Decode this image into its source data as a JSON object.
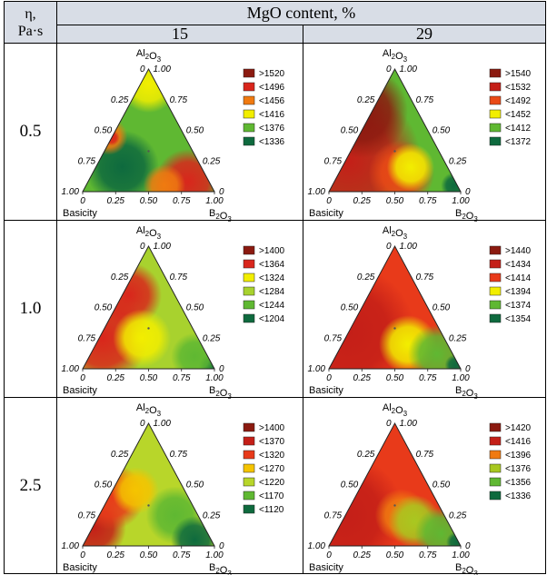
{
  "header": {
    "eta_label_line1": "η,",
    "eta_label_line2": "Pa·s",
    "mgo_title": "MgO content, %",
    "columns": [
      "15",
      "29"
    ]
  },
  "corner_labels": {
    "top": "Al2O3",
    "bottom_left": "Basicity",
    "bottom_right": "B2O3"
  },
  "ticks": {
    "bottom": [
      "0",
      "0.25",
      "0.50",
      "0.75",
      "1.00"
    ],
    "left": [
      "1.00",
      "0.75",
      "0.50",
      "0.25",
      "0"
    ],
    "right": [
      "1.00",
      "0.75",
      "0.50",
      "0.25",
      "0"
    ]
  },
  "rows": [
    {
      "eta": "0.5",
      "panels": [
        {
          "legend": [
            ">1520",
            "<1496",
            "<1456",
            "<1416",
            "<1376",
            "<1336"
          ],
          "colors": [
            "#8b1a10",
            "#d9261c",
            "#f07a10",
            "#f2ee00",
            "#5fb832",
            "#0e6a3e"
          ]
        },
        {
          "legend": [
            ">1540",
            "<1532",
            "<1492",
            "<1452",
            "<1412",
            "<1372"
          ],
          "colors": [
            "#8b1a10",
            "#c41f18",
            "#ea4a16",
            "#f2ee00",
            "#5fb832",
            "#0e6a3e"
          ]
        }
      ]
    },
    {
      "eta": "1.0",
      "panels": [
        {
          "legend": [
            ">1400",
            "<1364",
            "<1324",
            "<1284",
            "<1244",
            "<1204"
          ],
          "colors": [
            "#8b1a10",
            "#d9261c",
            "#f2ee00",
            "#a8d22e",
            "#5fb832",
            "#0e6a3e"
          ]
        },
        {
          "legend": [
            ">1440",
            "<1434",
            "<1414",
            "<1394",
            "<1374",
            "<1354"
          ],
          "colors": [
            "#8b1a10",
            "#c41f18",
            "#e83a1a",
            "#f2ee00",
            "#5fb832",
            "#0e6a3e"
          ]
        }
      ]
    },
    {
      "eta": "2.5",
      "panels": [
        {
          "legend": [
            ">1400",
            "<1370",
            "<1320",
            "<1270",
            "<1220",
            "<1170",
            "<1120"
          ],
          "colors": [
            "#8b1a10",
            "#c41f18",
            "#e83a1a",
            "#f5c400",
            "#b8d62a",
            "#5fb832",
            "#0e6a3e"
          ]
        },
        {
          "legend": [
            ">1420",
            "<1416",
            "<1396",
            "<1376",
            "<1356",
            "<1336"
          ],
          "colors": [
            "#8b1a10",
            "#c41f18",
            "#f07a10",
            "#a8c820",
            "#5fb832",
            "#0e6a3e"
          ]
        }
      ]
    }
  ]
}
